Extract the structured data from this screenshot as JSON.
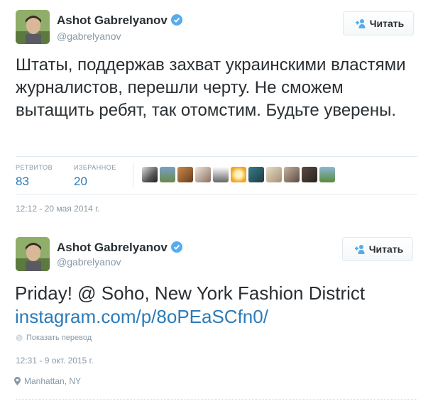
{
  "tweet1": {
    "name": "Ashot Gabrelyanov",
    "handle": "@gabrelyanov",
    "follow_label": "Читать",
    "text": "Штаты, поддержав захват украинскими властями журналистов, перешли черту. Не сможем вытащить ребят, так отомстим. Будьте уверены.",
    "retweets_label": "РЕТВИТОВ",
    "retweets_count": "83",
    "favorites_label": "ИЗБРАННОЕ",
    "favorites_count": "20",
    "timestamp": "12:12 - 20 мая 2014 г."
  },
  "tweet2": {
    "name": "Ashot Gabrelyanov",
    "handle": "@gabrelyanov",
    "follow_label": "Читать",
    "text": "Priday! @ Soho, New York Fashion District",
    "link": "instagram.com/p/8oPEaSCfn0/",
    "translate_label": "Показать перевод",
    "timestamp": "12:31 - 9 окт. 2015 г.",
    "location": "Manhattan, NY"
  },
  "colors": {
    "accent": "#2b7bb9",
    "verified": "#55acee",
    "muted": "#8899a6"
  }
}
